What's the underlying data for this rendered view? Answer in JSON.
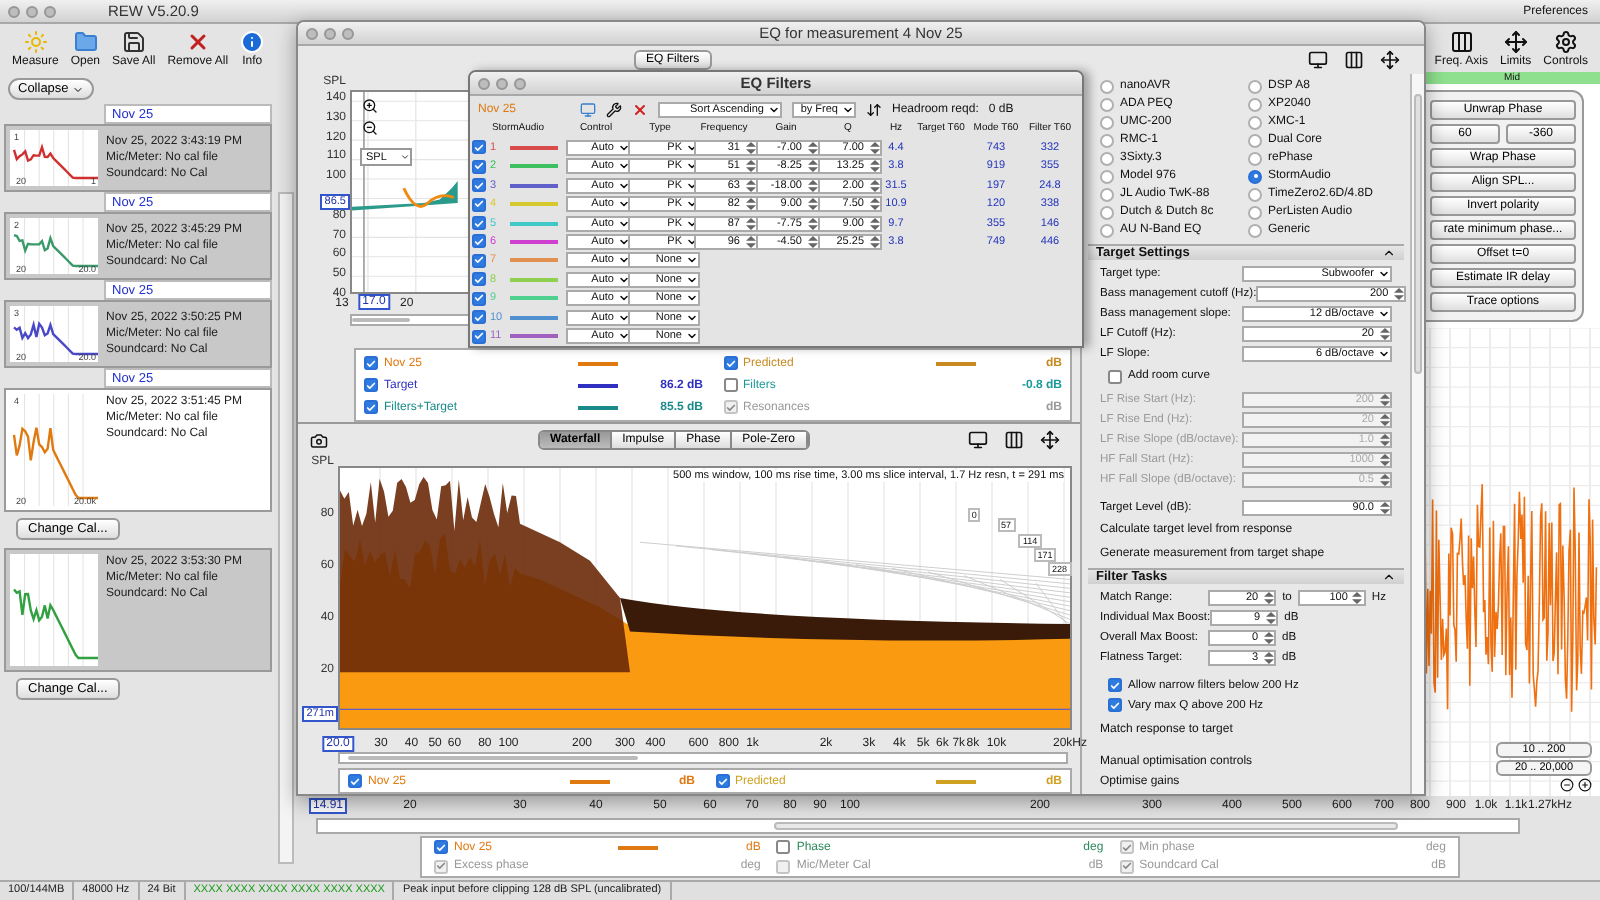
{
  "window": {
    "title": "REW V5.20.9"
  },
  "toolbar": [
    {
      "label": "Measure"
    },
    {
      "label": "Open"
    },
    {
      "label": "Save All"
    },
    {
      "label": "Remove All"
    },
    {
      "label": "Info"
    }
  ],
  "right_toolbar": [
    {
      "label": "Preferences"
    },
    {
      "label": "Freq. Axis"
    },
    {
      "label": "Limits"
    },
    {
      "label": "Controls"
    }
  ],
  "measurements": {
    "collapse_button": "Collapse",
    "items": [
      {
        "name": "Nov 25",
        "index": "1",
        "date": "Nov 25, 2022 3:43:19 PM",
        "mic": "Mic/Meter: No cal file",
        "soundcard": "Soundcard: No Cal",
        "color": "#d03030",
        "selected": false,
        "x_min": "20",
        "x_max": "1"
      },
      {
        "name": "Nov 25",
        "index": "2",
        "date": "Nov 25, 2022 3:45:29 PM",
        "mic": "Mic/Meter: No cal file",
        "soundcard": "Soundcard: No Cal",
        "color": "#3a9a6a",
        "selected": false,
        "x_min": "20",
        "x_max": "20.0"
      },
      {
        "name": "Nov 25",
        "index": "3",
        "date": "Nov 25, 2022 3:50:25 PM",
        "mic": "Mic/Meter: No cal file",
        "soundcard": "Soundcard: No Cal",
        "color": "#4848c8",
        "selected": false,
        "x_min": "20",
        "x_max": "20.0"
      },
      {
        "name": "Nov 25",
        "index": "4",
        "date": "Nov 25, 2022 3:51:45 PM",
        "mic": "Mic/Meter: No cal file",
        "soundcard": "Soundcard: No Cal",
        "color": "#e07a10",
        "selected": true,
        "x_min": "20",
        "x_max": "20.0k",
        "change_cal": "Change Cal..."
      },
      {
        "date": "Nov 25, 2022 3:53:30 PM",
        "mic": "Mic/Meter: No cal file",
        "soundcard": "Soundcard: No Cal",
        "color": "#30a040",
        "selected": false,
        "change_cal": "Change Cal..."
      }
    ]
  },
  "main_graph": {
    "mid_label": "Mid",
    "button_rows": [
      [
        "Unwrap Phase"
      ],
      [
        "60",
        "-360"
      ],
      [
        "Wrap Phase"
      ],
      [
        "Align SPL..."
      ],
      [
        "Invert polarity"
      ],
      [
        "rate minimum phase..."
      ],
      [
        "Offset t=0"
      ],
      [
        "Estimate IR delay"
      ],
      [
        "Trace options"
      ]
    ],
    "range_buttons": [
      "10 .. 200",
      "20 .. 20,000"
    ],
    "x_axis": [
      "14.91",
      "20",
      "30",
      "40",
      "50",
      "60",
      "70",
      "80",
      "90",
      "100",
      "200",
      "300",
      "400",
      "500",
      "600",
      "700",
      "800",
      "900",
      "1.0k",
      "1.1k",
      "1.27kHz"
    ]
  },
  "main_legend": [
    {
      "label": "Nov 25",
      "checked": true,
      "disabled": false,
      "color": "#e07a10",
      "unit": "dB"
    },
    {
      "label": "Phase",
      "checked": false,
      "disabled": false,
      "color": "#2a8a5a",
      "unit": "deg"
    },
    {
      "label": "Min phase",
      "checked": true,
      "disabled": true,
      "unit": "deg"
    },
    {
      "label": "Excess phase",
      "checked": true,
      "disabled": true,
      "unit": "deg"
    },
    {
      "label": "Mic/Meter Cal",
      "checked": false,
      "disabled": true,
      "unit": "dB"
    },
    {
      "label": "Soundcard Cal",
      "checked": true,
      "disabled": true,
      "unit": "dB"
    }
  ],
  "status_bar": [
    {
      "text": "100/144MB",
      "kind": "plain"
    },
    {
      "text": "48000 Hz",
      "kind": "plain"
    },
    {
      "text": "24 Bit",
      "kind": "plain"
    },
    {
      "text": "XXXX XXXX  XXXX XXXX  XXXX XXXX",
      "kind": "levels"
    },
    {
      "text": "Peak input before clipping 128 dB SPL (uncalibrated)",
      "kind": "plain"
    }
  ],
  "eq_window": {
    "title": "EQ for measurement 4 Nov 25",
    "filters_button": "EQ Filters",
    "top_graph": {
      "ylabel": "SPL",
      "view": "SPL",
      "yticks": [
        "140",
        "130",
        "120",
        "110",
        "100",
        "80",
        "70",
        "60",
        "50",
        "40"
      ],
      "level_marker": "86.5",
      "freq_marker": "17.0",
      "xticks": [
        "13",
        "20"
      ]
    },
    "legend": [
      {
        "label": "Nov 25",
        "checked": true,
        "disabled": false,
        "color": "#e07a10"
      },
      {
        "label": "Target",
        "checked": true,
        "disabled": false,
        "color": "#3030c0",
        "value": "86.2 dB"
      },
      {
        "label": "Filters+Target",
        "checked": true,
        "disabled": false,
        "color": "#1a8a8a",
        "value": "85.5 dB"
      },
      {
        "label": "Predicted",
        "checked": true,
        "disabled": false,
        "color": "#c88a20",
        "value": "dB"
      },
      {
        "label": "Filters",
        "checked": false,
        "disabled": false,
        "color": "#1a9a9a",
        "value": "-0.8 dB"
      },
      {
        "label": "Resonances",
        "checked": true,
        "disabled": true,
        "value": "dB"
      }
    ],
    "bottom_graph": {
      "tabs": [
        {
          "label": "Waterfall",
          "selected": true
        },
        {
          "label": "Impulse",
          "selected": false
        },
        {
          "label": "Phase",
          "selected": false
        },
        {
          "label": "Pole-Zero",
          "selected": false
        }
      ],
      "ylabel": "SPL",
      "yticks": [
        "80",
        "60",
        "40",
        "20"
      ],
      "time_marker": "271m",
      "caption": "500 ms window, 100 ms rise time, 3.00 ms slice interval, 1.7 Hz resn, t = 291 ms",
      "slice_labels": [
        "0",
        "57",
        "114",
        "171",
        "228"
      ],
      "freq_marker": "20.0",
      "xticks": [
        "30",
        "40",
        "50",
        "60",
        "80",
        "100",
        "200",
        "300",
        "400",
        "600",
        "800",
        "1k",
        "2k",
        "3k",
        "4k",
        "5k",
        "6k",
        "7k",
        "8k",
        "10k",
        "20kHz"
      ]
    },
    "bottom_legend": [
      {
        "label": "Nov 25",
        "checked": true,
        "color": "#e07a10",
        "unit": "dB"
      },
      {
        "label": "Predicted",
        "checked": true,
        "color": "#d0a020",
        "unit": "dB"
      }
    ],
    "equalizers": [
      {
        "label": "nanoAVR",
        "selected": false
      },
      {
        "label": "DSP A8",
        "selected": false
      },
      {
        "label": "ADA PEQ",
        "selected": false
      },
      {
        "label": "XP2040",
        "selected": false
      },
      {
        "label": "UMC-200",
        "selected": false
      },
      {
        "label": "XMC-1",
        "selected": false
      },
      {
        "label": "RMC-1",
        "selected": false
      },
      {
        "label": "Dual Core",
        "selected": false
      },
      {
        "label": "3Sixty.3",
        "selected": false
      },
      {
        "label": "rePhase",
        "selected": false
      },
      {
        "label": "Model 976",
        "selected": false
      },
      {
        "label": "StormAudio",
        "selected": true
      },
      {
        "label": "JL Audio TwK-88",
        "selected": false
      },
      {
        "label": "TimeZero2.6D/4.8D",
        "selected": false
      },
      {
        "label": "Dutch & Dutch 8c",
        "selected": false
      },
      {
        "label": "PerListen Audio",
        "selected": false
      },
      {
        "label": "AU N-Band EQ",
        "selected": false
      },
      {
        "label": "Generic",
        "selected": false
      }
    ],
    "target_settings": {
      "title": "Target Settings",
      "rows": [
        {
          "kind": "select",
          "label": "Target type:",
          "value": "Subwoofer",
          "disabled": false
        },
        {
          "kind": "number",
          "label": "Bass management cutoff (Hz):",
          "value": "200",
          "disabled": false
        },
        {
          "kind": "select",
          "label": "Bass management slope:",
          "value": "12 dB/octave",
          "disabled": false
        },
        {
          "kind": "number",
          "label": "LF Cutoff (Hz):",
          "value": "20",
          "disabled": false
        },
        {
          "kind": "select",
          "label": "LF Slope:",
          "value": "6 dB/octave",
          "disabled": false
        },
        {
          "kind": "checkbox",
          "label": "Add room curve",
          "checked": false
        },
        {
          "kind": "number",
          "label": "LF Rise Start (Hz):",
          "value": "200",
          "disabled": true
        },
        {
          "kind": "number",
          "label": "LF Rise End (Hz):",
          "value": "20",
          "disabled": true
        },
        {
          "kind": "number",
          "label": "LF Rise Slope (dB/octave):",
          "value": "1.0",
          "disabled": true
        },
        {
          "kind": "number",
          "label": "HF Fall Start (Hz):",
          "value": "1000",
          "disabled": true
        },
        {
          "kind": "number",
          "label": "HF Fall Slope (dB/octave):",
          "value": "0.5",
          "disabled": true
        },
        {
          "kind": "number",
          "label": "Target Level (dB):",
          "value": "90.0",
          "disabled": false
        },
        {
          "kind": "action",
          "label": "Calculate target level from response"
        },
        {
          "kind": "action",
          "label": "Generate measurement from target shape"
        }
      ]
    },
    "filter_tasks": {
      "title": "Filter Tasks",
      "match_range": {
        "label": "Match Range:",
        "from": "20",
        "to_label": "to",
        "to": "100",
        "unit": "Hz"
      },
      "rows": [
        {
          "label": "Individual Max Boost:",
          "value": "9",
          "unit": "dB"
        },
        {
          "label": "Overall Max Boost:",
          "value": "0",
          "unit": "dB"
        },
        {
          "label": "Flatness Target:",
          "value": "3",
          "unit": "dB"
        }
      ],
      "options": [
        {
          "label": "Allow narrow filters below 200 Hz",
          "checked": true
        },
        {
          "label": "Vary max Q above 200 Hz",
          "checked": true
        }
      ],
      "actions": [
        "Match response to target",
        "Manual optimisation controls",
        "Optimise gains"
      ]
    }
  },
  "eq_filters": {
    "title": "EQ Filters",
    "measurement": "Nov 25",
    "sort": "Sort Ascending",
    "sort_by": "by Freq",
    "headroom_label": "Headroom reqd:",
    "headroom": "0 dB",
    "columns": [
      "StormAudio",
      "Control",
      "Type",
      "Frequency",
      "Gain",
      "Q",
      "Hz",
      "Target T60",
      "Mode T60",
      "Filter T60"
    ],
    "filters": [
      {
        "index": "1",
        "enabled": true,
        "color": "#d94c4c",
        "control": "Auto",
        "type": "PK",
        "frequency": "31",
        "gain": "-7.00",
        "q": "7.00",
        "hz": "4.4",
        "mode_t60": "743",
        "filter_t60": "332"
      },
      {
        "index": "2",
        "enabled": true,
        "color": "#3cc060",
        "control": "Auto",
        "type": "PK",
        "frequency": "51",
        "gain": "-8.25",
        "q": "13.25",
        "hz": "3.8",
        "mode_t60": "919",
        "filter_t60": "355"
      },
      {
        "index": "3",
        "enabled": true,
        "color": "#6060c8",
        "control": "Auto",
        "type": "PK",
        "frequency": "63",
        "gain": "-18.00",
        "q": "2.00",
        "hz": "31.5",
        "mode_t60": "197",
        "filter_t60": "24.8"
      },
      {
        "index": "4",
        "enabled": true,
        "color": "#d8c830",
        "control": "Auto",
        "type": "PK",
        "frequency": "82",
        "gain": "9.00",
        "q": "7.50",
        "hz": "10.9",
        "mode_t60": "120",
        "filter_t60": "338"
      },
      {
        "index": "5",
        "enabled": true,
        "color": "#40c8c8",
        "control": "Auto",
        "type": "PK",
        "frequency": "87",
        "gain": "-7.75",
        "q": "9.00",
        "hz": "9.7",
        "mode_t60": "355",
        "filter_t60": "146"
      },
      {
        "index": "6",
        "enabled": true,
        "color": "#d040d0",
        "control": "Auto",
        "type": "PK",
        "frequency": "96",
        "gain": "-4.50",
        "q": "25.25",
        "hz": "3.8",
        "mode_t60": "749",
        "filter_t60": "446"
      },
      {
        "index": "7",
        "enabled": true,
        "color": "#e09050",
        "control": "Auto",
        "type": "None"
      },
      {
        "index": "8",
        "enabled": true,
        "color": "#90d050",
        "control": "Auto",
        "type": "None"
      },
      {
        "index": "9",
        "enabled": true,
        "color": "#50d090",
        "control": "Auto",
        "type": "None"
      },
      {
        "index": "10",
        "enabled": true,
        "color": "#5090d0",
        "control": "Auto",
        "type": "None"
      },
      {
        "index": "11",
        "enabled": true,
        "color": "#a060c0",
        "control": "Auto",
        "type": "None"
      }
    ]
  }
}
